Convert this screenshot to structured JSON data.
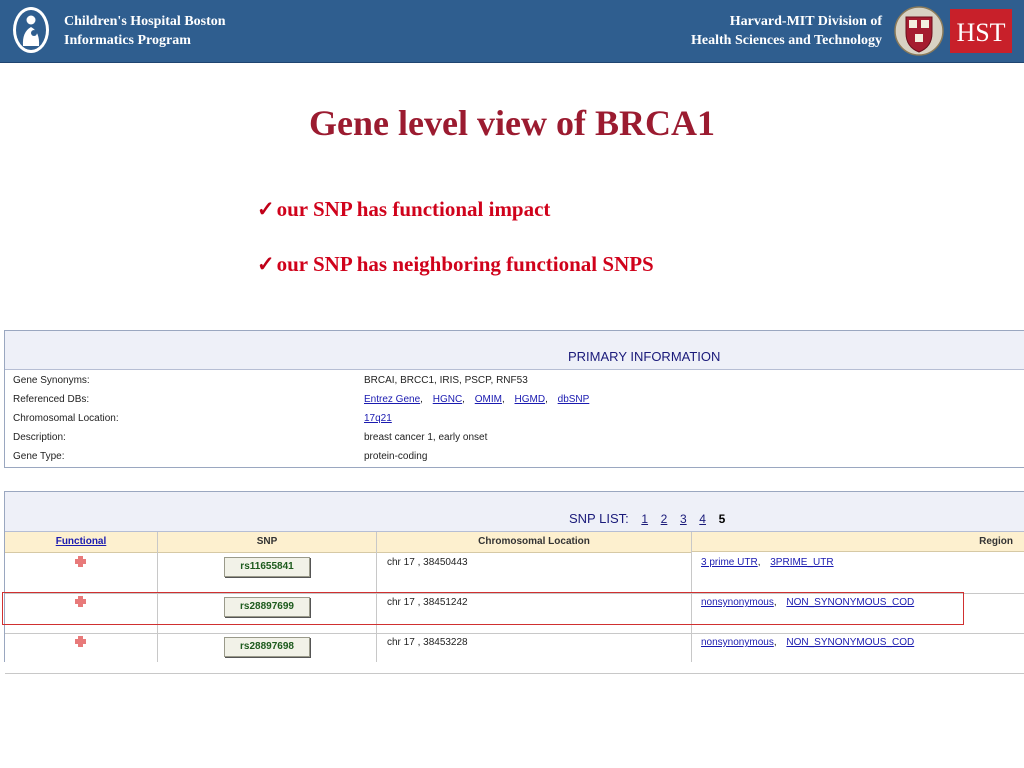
{
  "banner": {
    "left_line1": "Children's Hospital Boston",
    "left_line2": "Informatics Program",
    "right_line1": "Harvard-MIT Division of",
    "right_line2": "Health Sciences and Technology",
    "hst_logo_text": "HST",
    "colors": {
      "banner_bg": "#2f5e8f",
      "hst_red": "#c8202a",
      "shield_crimson": "#a51c30"
    }
  },
  "slide": {
    "title": "Gene level view of BRCA1",
    "check_glyph": "✓",
    "bullets": [
      "our SNP has functional impact",
      "our SNP has neighboring functional SNPS"
    ]
  },
  "primary": {
    "title": "PRIMARY INFORMATION",
    "rows": [
      {
        "label": "Gene Synonyms:",
        "value": "BRCAI, BRCC1, IRIS, PSCP, RNF53"
      },
      {
        "label": "Referenced DBs:",
        "links": [
          "Entrez Gene",
          "HGNC",
          "OMIM",
          "HGMD",
          "dbSNP"
        ]
      },
      {
        "label": "Chromosomal Location:",
        "link": "17q21"
      },
      {
        "label": "Description:",
        "value": "breast cancer 1, early onset"
      },
      {
        "label": "Gene Type:",
        "value": "protein-coding"
      }
    ]
  },
  "snp_list": {
    "title": "SNP LIST:",
    "pages": [
      "1",
      "2",
      "3",
      "4",
      "5"
    ],
    "current_page": "5",
    "columns": [
      "Functional",
      "SNP",
      "Chromosomal Location",
      "Region"
    ],
    "rows": [
      {
        "snp": "rs11655841",
        "location": "chr 17 , 38450443",
        "region": [
          "3 prime UTR",
          "3PRIME_UTR"
        ]
      },
      {
        "snp": "rs28897699",
        "location": "chr 17 , 38451242",
        "region": [
          "nonsynonymous",
          "NON_SYNONYMOUS_COD"
        ],
        "highlighted": true
      },
      {
        "snp": "rs28897698",
        "location": "chr 17 , 38453228",
        "region": [
          "nonsynonymous",
          "NON_SYNONYMOUS_COD"
        ]
      }
    ]
  }
}
